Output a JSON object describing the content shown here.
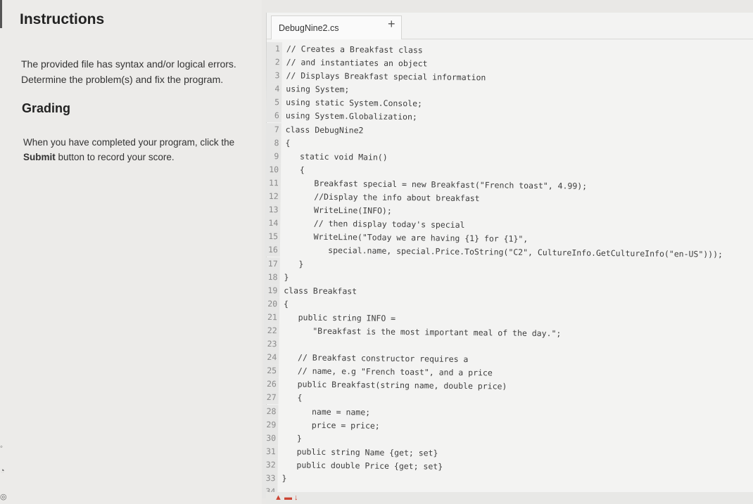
{
  "instructions": {
    "title": "Instructions",
    "line1": "The provided file has syntax and/or logical errors.",
    "line2": "Determine the problem(s) and fix the program."
  },
  "grading": {
    "title": "Grading",
    "line1": "When you have completed your program, click the",
    "submit_word": "Submit",
    "line2_rest": " button to record your score."
  },
  "editor": {
    "tab_label": "DebugNine2.cs",
    "add_tab": "+",
    "lines": [
      "// Creates a Breakfast class",
      "// and instantiates an object",
      "// Displays Breakfast special information",
      "using System;",
      "using static System.Console;",
      "using System.Globalization;",
      "class DebugNine2",
      "{",
      "   static void Main()",
      "   {",
      "      Breakfast special = new Breakfast(\"French toast\", 4.99);",
      "      //Display the info about breakfast",
      "      WriteLine(INFO);",
      "      // then display today's special",
      "      WriteLine(\"Today we are having {1} for {1}\",",
      "         special.name, special.Price.ToString(\"C2\", CultureInfo.GetCultureInfo(\"en-US\")));",
      "   }",
      "}",
      "class Breakfast",
      "{",
      "   public string INFO =",
      "      \"Breakfast is the most important meal of the day.\";",
      "",
      "   // Breakfast constructor requires a",
      "   // name, e.g \"French toast\", and a price",
      "   public Breakfast(string name, double price)",
      "   {",
      "      name = name;",
      "      price = price;",
      "   }",
      "   public string Name {get; set}",
      "   public double Price {get; set}",
      "}",
      ""
    ]
  },
  "colors": {
    "background": "#e9e8e6",
    "editor_bg": "#f3f3f2",
    "gutter_bg": "#e6e6e5"
  }
}
